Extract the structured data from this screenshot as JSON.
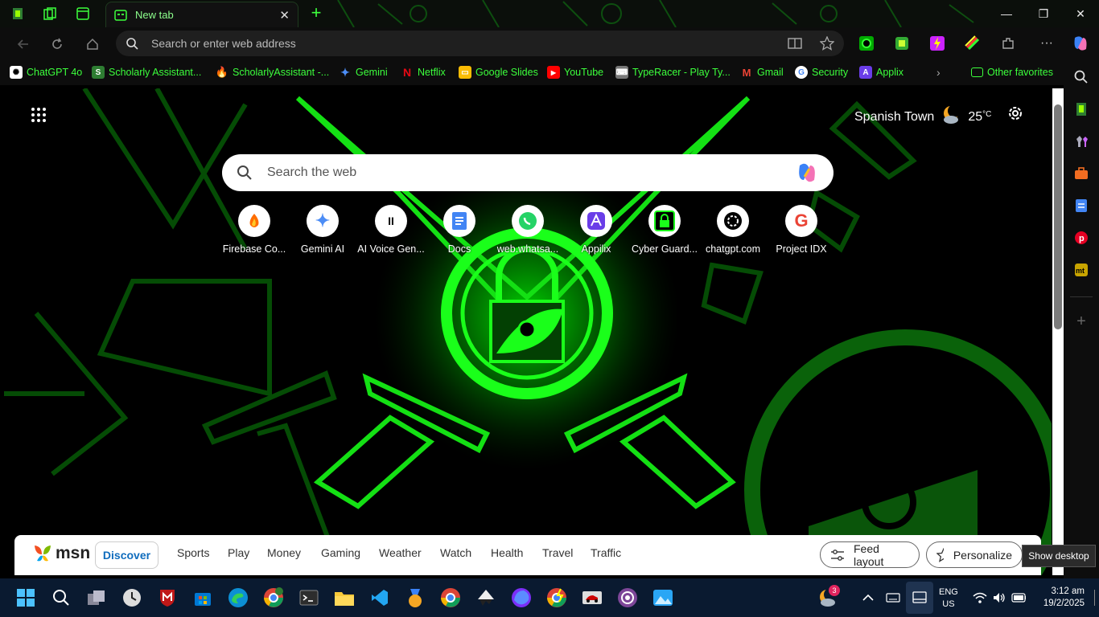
{
  "tab": {
    "title": "New tab"
  },
  "omnibox": {
    "placeholder": "Search or enter web address"
  },
  "favorites": [
    {
      "label": "ChatGPT 4o",
      "icon": "openai-icon",
      "color": "#e8e8e8"
    },
    {
      "label": "Scholarly Assistant...",
      "icon": "scholarly-icon",
      "color": "#2e7d32"
    },
    {
      "label": "ScholarlyAssistant -...",
      "icon": "firebase-icon",
      "color": "#ff8f00"
    },
    {
      "label": "Gemini",
      "icon": "gemini-icon",
      "color": "#4c8df6"
    },
    {
      "label": "Netflix",
      "icon": "netflix-icon",
      "color": "#e50914"
    },
    {
      "label": "Google Slides",
      "icon": "slides-icon",
      "color": "#fbbc04"
    },
    {
      "label": "YouTube",
      "icon": "youtube-icon",
      "color": "#ff0000"
    },
    {
      "label": "TypeRacer - Play Ty...",
      "icon": "typeracer-icon",
      "color": "#b0b0b0"
    },
    {
      "label": "Gmail",
      "icon": "gmail-icon",
      "color": "#ea4335"
    },
    {
      "label": "Security",
      "icon": "google-icon",
      "color": "#ffffff"
    },
    {
      "label": "Applix",
      "icon": "applix-icon",
      "color": "#6a3de8"
    }
  ],
  "other_favorites": "Other favorites",
  "weather": {
    "location": "Spanish Town",
    "temperature": "25",
    "unit": "°C"
  },
  "search": {
    "placeholder": "Search the web"
  },
  "tiles": [
    {
      "label": "Firebase Co...",
      "icon": "firebase-icon",
      "color": "#ff6d00"
    },
    {
      "label": "Gemini AI",
      "icon": "gemini-icon",
      "color": "#4c8df6"
    },
    {
      "label": "AI Voice Gen...",
      "icon": "pause-icon",
      "color": "#111111"
    },
    {
      "label": "Docs",
      "icon": "docs-icon",
      "color": "#4285f4"
    },
    {
      "label": "web.whatsa...",
      "icon": "whatsapp-icon",
      "color": "#25d366"
    },
    {
      "label": "Appilix",
      "icon": "applix-icon",
      "color": "#6a3de8"
    },
    {
      "label": "Cyber Guard...",
      "icon": "lock-icon",
      "color": "#1aff1a"
    },
    {
      "label": "chatgpt.com",
      "icon": "openai-icon",
      "color": "#000000"
    },
    {
      "label": "Project IDX",
      "icon": "google-icon",
      "color": "#ea4335"
    }
  ],
  "msn": {
    "logo": "msn",
    "discover": "Discover",
    "nav": [
      "Sports",
      "Play",
      "Money",
      "Gaming",
      "Weather",
      "Watch",
      "Health",
      "Travel",
      "Traffic"
    ],
    "feed_layout": "Feed layout",
    "personalize": "Personalize"
  },
  "tooltip": "Show desktop",
  "taskbar": {
    "lang_line1": "ENG",
    "lang_line2": "US",
    "time": "3:12 am",
    "date": "19/2/2025",
    "badge": "3"
  },
  "colors": {
    "accent": "#1aff1a",
    "taskbar": "#0a1a30",
    "msn_blue": "#0f6cbd"
  }
}
